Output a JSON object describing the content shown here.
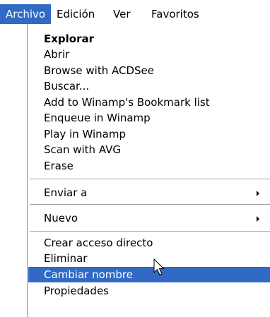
{
  "menubar": {
    "items": [
      {
        "label": "Archivo"
      },
      {
        "label": "Edición"
      },
      {
        "label": "Ver"
      },
      {
        "label": "Favoritos"
      }
    ],
    "active_index": 0
  },
  "menu": {
    "group1": [
      {
        "label": "Explorar"
      },
      {
        "label": "Abrir"
      },
      {
        "label": "Browse with ACDSee"
      },
      {
        "label": "Buscar..."
      },
      {
        "label": "Add to Winamp's Bookmark list"
      },
      {
        "label": "Enqueue in Winamp"
      },
      {
        "label": "Play in Winamp"
      },
      {
        "label": "Scan with AVG"
      },
      {
        "label": "Erase"
      }
    ],
    "send_to": {
      "label": "Enviar a"
    },
    "new": {
      "label": "Nuevo"
    },
    "group4": [
      {
        "label": "Crear acceso directo"
      },
      {
        "label": "Eliminar"
      },
      {
        "label": "Cambiar nombre"
      },
      {
        "label": "Propiedades"
      }
    ],
    "highlighted": "Cambiar nombre"
  },
  "colors": {
    "highlight": "#316ac5",
    "highlight_text": "#ffffff",
    "menu_background": "#ffffff",
    "separator": "#a0a0a0"
  },
  "icons": {
    "submenu_arrow": "triangle-right-icon",
    "cursor": "mouse-pointer-icon"
  }
}
